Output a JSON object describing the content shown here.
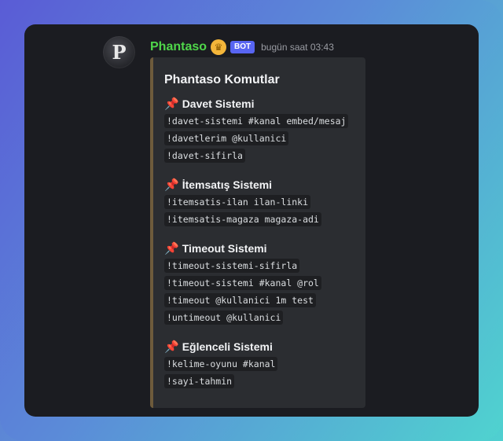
{
  "message": {
    "author": "Phantaso",
    "bot_tag": "BOT",
    "timestamp": "bugün saat 03:43",
    "avatar_letter": "P",
    "colors": {
      "username": "#4fd64a",
      "bot_tag": "#5865f2",
      "embed_bar": "#6e5b3c"
    }
  },
  "embed": {
    "title": "Phantaso Komutlar",
    "sections": [
      {
        "title": "Davet Sistemi",
        "commands": [
          "!davet-sistemi #kanal embed/mesaj",
          "!davetlerim @kullanici",
          "!davet-sifirla"
        ]
      },
      {
        "title": "İtemsatış Sistemi",
        "commands": [
          "!itemsatis-ilan ilan-linki",
          "!itemsatis-magaza magaza-adi"
        ]
      },
      {
        "title": "Timeout Sistemi",
        "commands": [
          "!timeout-sistemi-sifirla",
          "!timeout-sistemi #kanal @rol",
          "!timeout @kullanici 1m test",
          "!untimeout @kullanici"
        ]
      },
      {
        "title": "Eğlenceli Sistemi",
        "commands": [
          "!kelime-oyunu #kanal",
          "!sayi-tahmin"
        ]
      }
    ]
  }
}
